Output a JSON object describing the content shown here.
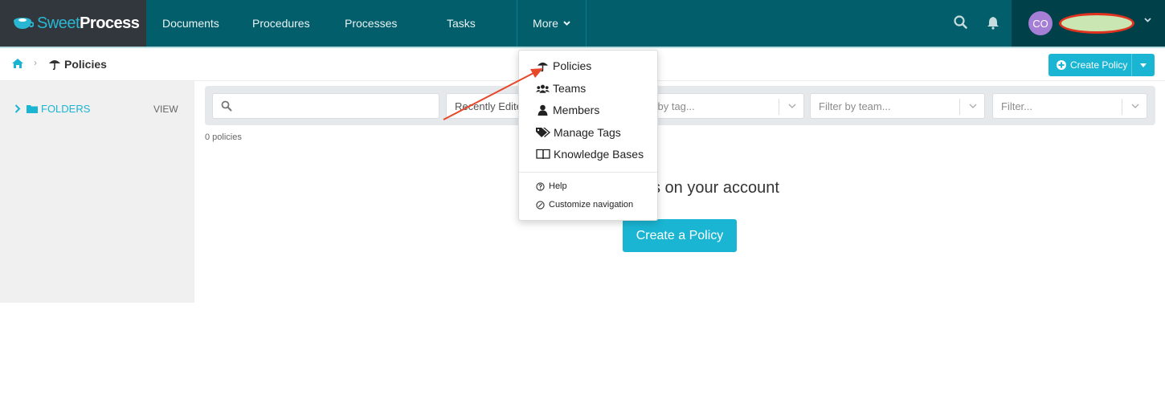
{
  "brand": {
    "name_light": "Sweet",
    "name_bold": "Process"
  },
  "nav": {
    "items": [
      "Documents",
      "Procedures",
      "Processes",
      "Tasks"
    ],
    "more_label": "More",
    "icons": [
      "search-icon",
      "bell-icon"
    ]
  },
  "user": {
    "initials": "CO",
    "name_redacted": true
  },
  "breadcrumb": {
    "home_icon": "home-icon",
    "current": "Policies",
    "current_icon": "umbrella-icon"
  },
  "toolbar": {
    "create_label": "Create Policy"
  },
  "sidebar": {
    "folders_label": "FOLDERS",
    "view_label": "VIEW"
  },
  "filters": {
    "search_placeholder": "",
    "sort_value": "Recently Edited",
    "tag_placeholder": "Filter by tag...",
    "team_placeholder": "Filter by team...",
    "other_placeholder": "Filter..."
  },
  "content": {
    "count": "0 policies",
    "empty_message": "There are no policies on your account",
    "empty_message_visible": "s on your account",
    "create_button": "Create a Policy"
  },
  "more_menu": {
    "items": [
      {
        "label": "Policies",
        "icon": "umbrella-icon"
      },
      {
        "label": "Teams",
        "icon": "users-icon"
      },
      {
        "label": "Members",
        "icon": "user-icon"
      },
      {
        "label": "Manage Tags",
        "icon": "tags-icon"
      },
      {
        "label": "Knowledge Bases",
        "icon": "book-icon"
      }
    ],
    "secondary": [
      {
        "label": "Help",
        "icon": "question-circle-icon"
      },
      {
        "label": "Customize navigation",
        "icon": "ban-circle-icon"
      }
    ]
  },
  "annotation": {
    "arrow_color": "#e8472a"
  },
  "colors": {
    "nav_bg": "#025e6b",
    "logo_bg": "#32373e",
    "accent": "#1ab5d3",
    "user_bg": "#004049"
  }
}
